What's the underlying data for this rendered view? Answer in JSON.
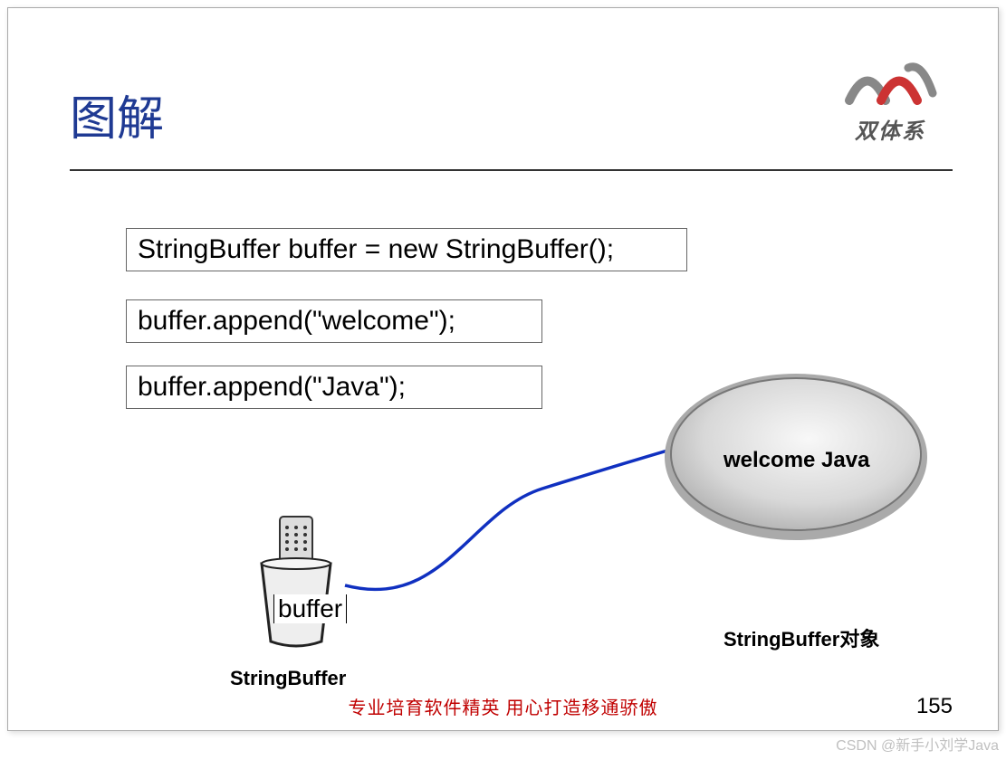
{
  "title": "图解",
  "logo_text": "双体系",
  "code": {
    "line1": "StringBuffer buffer = new StringBuffer();",
    "line2": "buffer.append(\"welcome\");",
    "line3": "buffer.append(\"Java\");"
  },
  "diagram": {
    "cup_var": "buffer",
    "cup_class": "StringBuffer",
    "stone_value": "welcome Java",
    "stone_class": "StringBuffer对象"
  },
  "footer": "专业培育软件精英    用心打造移通骄傲",
  "page": "155",
  "watermark": "CSDN @新手小刘学Java"
}
